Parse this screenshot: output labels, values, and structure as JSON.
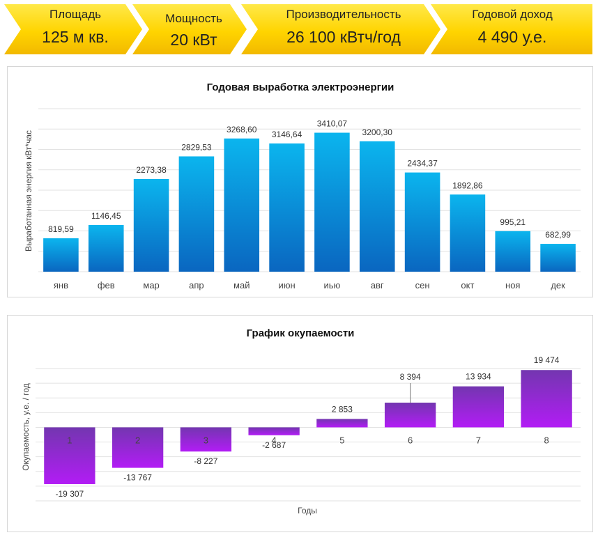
{
  "kpis": [
    {
      "label": "Площадь",
      "value": "125 м кв."
    },
    {
      "label": "Мощность",
      "value": "20 кВт"
    },
    {
      "label": "Производительность",
      "value": "26 100 кВтч/год"
    },
    {
      "label": "Годовой доход",
      "value": "4 490 у.е."
    }
  ],
  "colors": {
    "banner_fill": "#ffd700",
    "bar_blue_top": "#0bb5ee",
    "bar_blue_bottom": "#0a66c0",
    "bar_purple_top": "#b21cf5",
    "bar_purple_bottom": "#7336b0"
  },
  "chart_data": [
    {
      "type": "bar",
      "title": "Годовая выработка электроэнергии",
      "ylabel": "Выработанная энергия кВт*час",
      "xlabel": "",
      "categories": [
        "янв",
        "фев",
        "мар",
        "апр",
        "май",
        "июн",
        "иью",
        "авг",
        "сен",
        "окт",
        "ноя",
        "дек"
      ],
      "values": [
        819.59,
        1146.45,
        2273.38,
        2829.53,
        3268.6,
        3146.64,
        3410.07,
        3200.3,
        2434.37,
        1892.86,
        995.21,
        682.99
      ],
      "value_labels": [
        "819,59",
        "1146,45",
        "2273,38",
        "2829,53",
        "3268,60",
        "3146,64",
        "3410,07",
        "3200,30",
        "2434,37",
        "1892,86",
        "995,21",
        "682,99"
      ],
      "ylim": [
        0,
        4000
      ],
      "grid": true,
      "legend": "none"
    },
    {
      "type": "bar",
      "title": "График окупаемости",
      "ylabel": "Окупаемость, у.е. / год",
      "xlabel": "Годы",
      "categories": [
        "1",
        "2",
        "3",
        "4",
        "5",
        "6",
        "7",
        "8"
      ],
      "values": [
        -19307,
        -13767,
        -8227,
        -2687,
        2853,
        8394,
        13934,
        19474
      ],
      "value_labels": [
        "-19 307",
        "-13 767",
        "-8 227",
        "-2 687",
        "2 853",
        "8 394",
        "13 934",
        "19 474"
      ],
      "ylim": [
        -25000,
        20000
      ],
      "grid": true,
      "legend": "none"
    }
  ]
}
